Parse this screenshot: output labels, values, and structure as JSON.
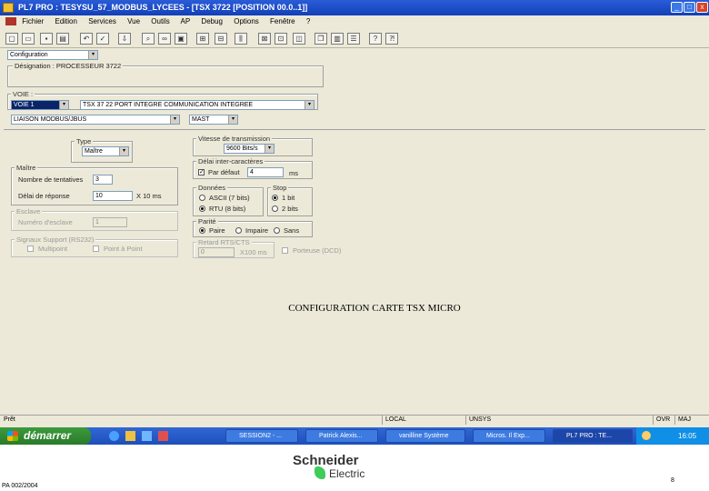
{
  "window": {
    "title": "PL7 PRO : TESYSU_57_MODBUS_LYCEES - [TSX 3722 [POSITION 00.0..1]]",
    "controls": [
      "_",
      "□",
      "x"
    ]
  },
  "menu": [
    "Fichier",
    "Edition",
    "Services",
    "Vue",
    "Outils",
    "AP",
    "Debug",
    "Options",
    "Fenêtre",
    "?"
  ],
  "config": {
    "combo_top": "Configuration",
    "designation": "Désignation : PROCESSEUR 3722",
    "voie_label": "VOIE :",
    "voie_value": "VOIE 1",
    "voie_desc": "TSX 37 22 PORT INTEGRE COMMUNICATION INTEGREE",
    "link_value": "LIAISON MODBUS/JBUS",
    "mast_value": "MAST"
  },
  "type_group": {
    "label": "Type",
    "value": "Maître"
  },
  "maitre_group": {
    "label": "Maître",
    "nb_essais_label": "Nombre de tentatives",
    "nb_essais_value": "3",
    "delai_label": "Délai de réponse",
    "delai_value": "10",
    "delai_unit": "X 10 ms"
  },
  "esclave_group": {
    "label": "Esclave",
    "numero_label": "Numéro d'esclave",
    "numero_value": "1"
  },
  "signaux_group": {
    "label": "Signaux Support (RS232)",
    "opt1": "Multipoint",
    "opt2": "Point à Point"
  },
  "vitesse_group": {
    "label": "Vitesse de transmission",
    "value": "9600 Bits/s"
  },
  "delai_inter_group": {
    "label": "Délai inter-caractères",
    "chk_label": "Par défaut",
    "value": "4",
    "unit": "ms"
  },
  "donnees_group": {
    "label": "Données",
    "opt1": "ASCII (7 bits)",
    "opt2": "RTU (8 bits)"
  },
  "stop_group": {
    "label": "Stop",
    "opt1": "1 bit",
    "opt2": "2 bits"
  },
  "parite_group": {
    "label": "Parité",
    "opt1": "Paire",
    "opt2": "Impaire",
    "opt3": "Sans"
  },
  "retard_group": {
    "label": "Retard RTS/CTS",
    "value": "0",
    "unit": "X100 ms",
    "chk_label": "Porteuse (DCD)"
  },
  "caption": "CONFIGURATION CARTE TSX MICRO",
  "status": {
    "left": "Prêt",
    "local": "LOCAL",
    "unisys": "UNSYS",
    "ovr": "OVR",
    "maj": "MAJ"
  },
  "taskbar": {
    "start": "démarrer",
    "tasks": [
      "SESSION2 - ...",
      "Patrick Alexis...",
      "vanilline Système",
      "Micros. Il Exp...",
      "PL7 PRO : TE..."
    ],
    "clock": "16:05"
  },
  "footer": {
    "brand_top": "Schneider",
    "brand_bottom": "Electric",
    "ref": "PA 002/2004",
    "page": "8"
  },
  "colors": {
    "title_bar": "#1240b8",
    "dialog_bg": "#ece9d8",
    "taskbar": "#1d4fba",
    "brand_green": "#3dcd58"
  }
}
